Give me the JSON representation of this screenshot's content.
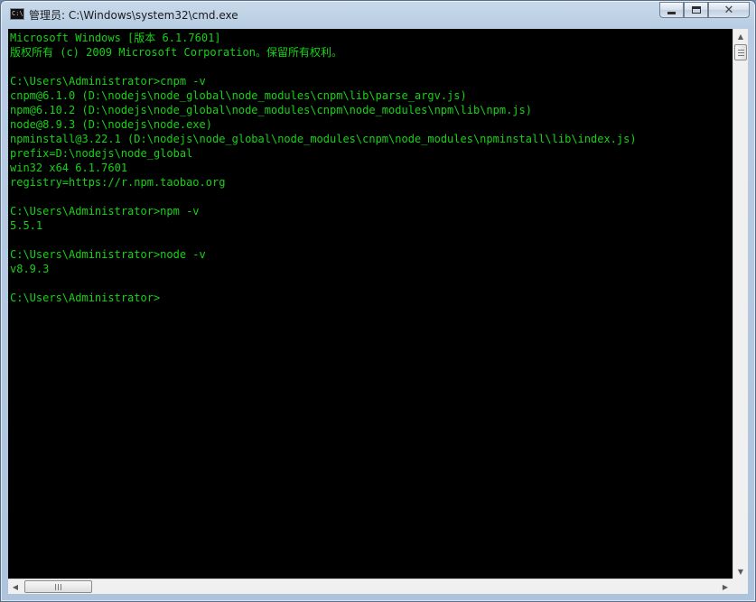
{
  "window": {
    "title": "管理员: C:\\Windows\\system32\\cmd.exe",
    "icon_label": "C:\\",
    "buttons": {
      "minimize": "minimize",
      "maximize": "maximize",
      "close": "✕"
    }
  },
  "colors": {
    "console_bg": "#000000",
    "console_fg": "#16d216",
    "chrome": "#c9d9ea"
  },
  "console": {
    "lines": [
      "Microsoft Windows [版本 6.1.7601]",
      "版权所有 (c) 2009 Microsoft Corporation。保留所有权利。",
      "",
      "C:\\Users\\Administrator>cnpm -v",
      "cnpm@6.1.0 (D:\\nodejs\\node_global\\node_modules\\cnpm\\lib\\parse_argv.js)",
      "npm@6.10.2 (D:\\nodejs\\node_global\\node_modules\\cnpm\\node_modules\\npm\\lib\\npm.js)",
      "node@8.9.3 (D:\\nodejs\\node.exe)",
      "npminstall@3.22.1 (D:\\nodejs\\node_global\\node_modules\\cnpm\\node_modules\\npminstall\\lib\\index.js)",
      "prefix=D:\\nodejs\\node_global",
      "win32 x64 6.1.7601",
      "registry=https://r.npm.taobao.org",
      "",
      "C:\\Users\\Administrator>npm -v",
      "5.5.1",
      "",
      "C:\\Users\\Administrator>node -v",
      "v8.9.3",
      "",
      "C:\\Users\\Administrator>"
    ]
  },
  "scrollbars": {
    "up": "▲",
    "down": "▼",
    "left": "◀",
    "right": "▶"
  }
}
